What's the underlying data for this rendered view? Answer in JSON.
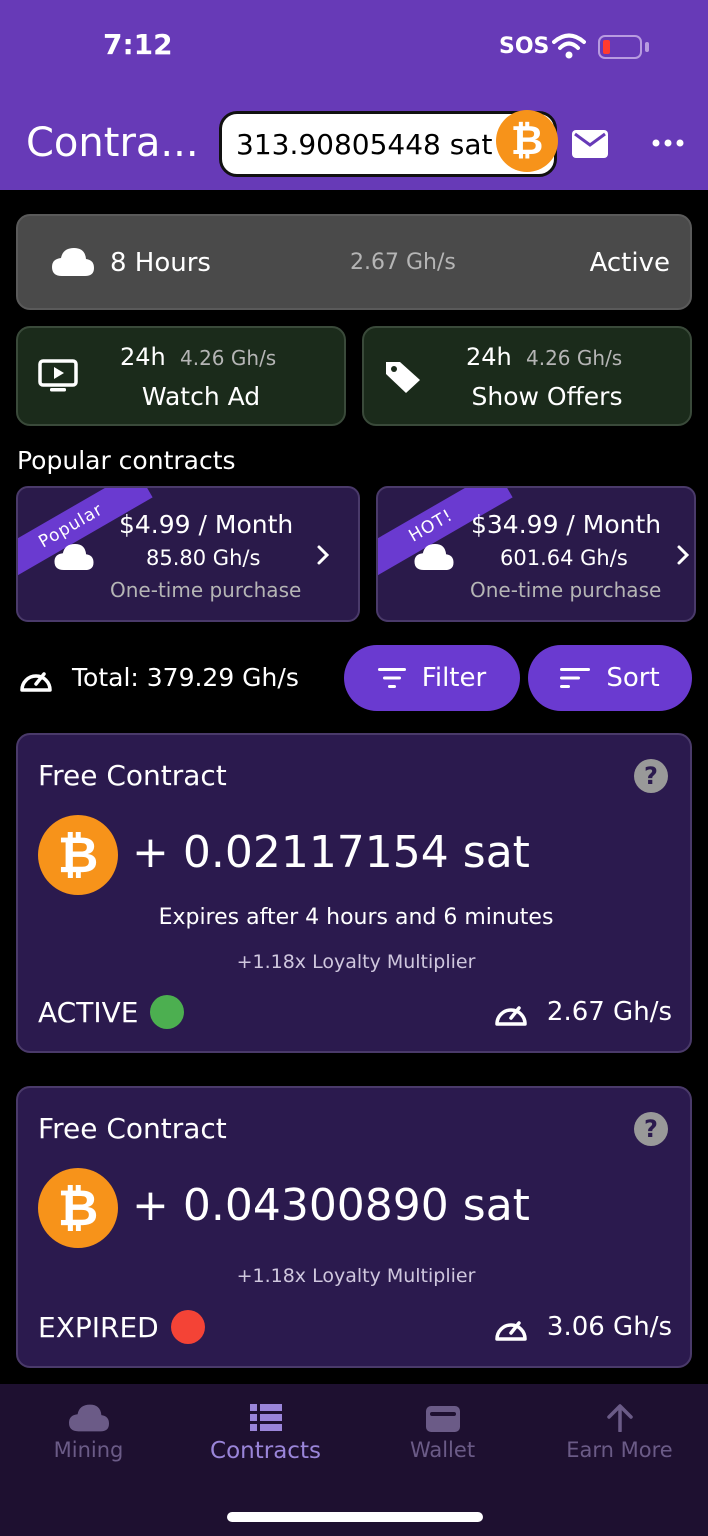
{
  "status_bar": {
    "time": "7:12",
    "sos": "SOS"
  },
  "header": {
    "title": "Contra...",
    "balance": "313.90805448 sat",
    "btc_symbol": "₿"
  },
  "active_boost": {
    "duration": "8 Hours",
    "speed": "2.67 Gh/s",
    "state": "Active"
  },
  "boosts": [
    {
      "duration": "24h",
      "speed": "4.26 Gh/s",
      "label": "Watch Ad",
      "icon": "tv-play-icon"
    },
    {
      "duration": "24h",
      "speed": "4.26 Gh/s",
      "label": "Show Offers",
      "icon": "tag-icon"
    }
  ],
  "popular": {
    "title": "Popular contracts",
    "items": [
      {
        "ribbon": "Popular",
        "price": "$4.99 / Month",
        "speed": "85.80 Gh/s",
        "type": "One-time purchase"
      },
      {
        "ribbon": "HOT!",
        "price": "$34.99 / Month",
        "speed": "601.64 Gh/s",
        "type": "One-time purchase"
      }
    ]
  },
  "toolbar": {
    "total": "Total: 379.29 Gh/s",
    "filter": "Filter",
    "sort": "Sort"
  },
  "contracts": [
    {
      "title": "Free Contract",
      "help": "?",
      "amount": "+ 0.02117154 sat",
      "expires": "Expires after 4 hours and 6 minutes",
      "loyalty": "+1.18x Loyalty Multiplier",
      "state": "ACTIVE",
      "state_color": "#4caf50",
      "speed": "2.67 Gh/s"
    },
    {
      "title": "Free Contract",
      "help": "?",
      "amount": "+ 0.04300890 sat",
      "loyalty": "+1.18x Loyalty Multiplier",
      "state": "EXPIRED",
      "state_color": "#f44336",
      "speed": "3.06 Gh/s"
    }
  ],
  "nav": [
    {
      "label": "Mining",
      "icon": "cloud-icon"
    },
    {
      "label": "Contracts",
      "icon": "list-icon",
      "active": true
    },
    {
      "label": "Wallet",
      "icon": "wallet-icon"
    },
    {
      "label": "Earn More",
      "icon": "arrow-up-icon"
    }
  ],
  "colors": {
    "primary": "#673ab7",
    "accent": "#6a3ad0",
    "bitcoin": "#f7931a"
  }
}
